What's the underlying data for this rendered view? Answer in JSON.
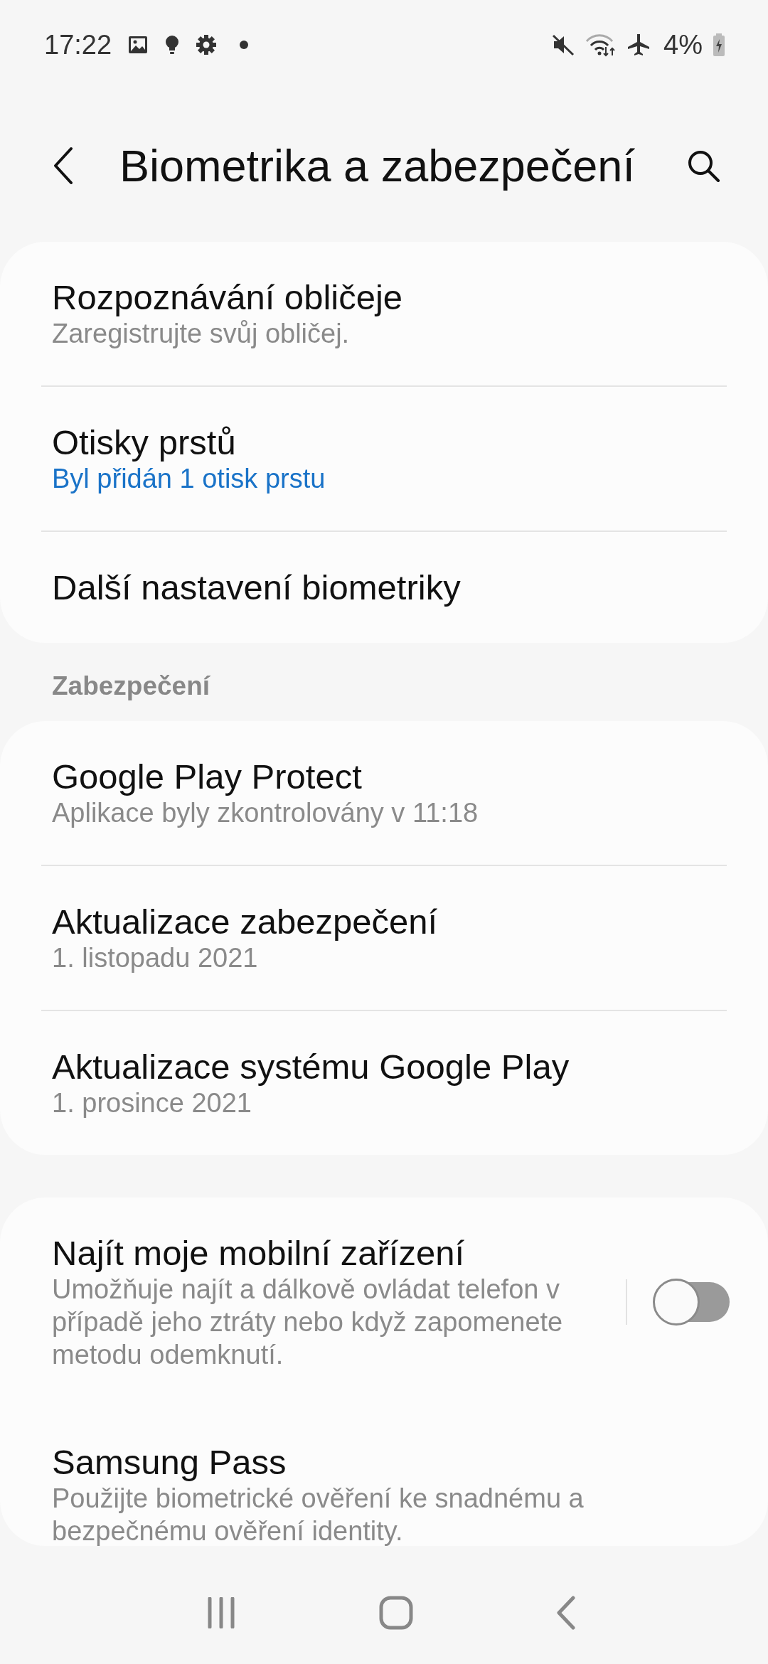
{
  "status_bar": {
    "time": "17:22",
    "battery": "4%"
  },
  "header": {
    "title": "Biometrika a zabezpečení"
  },
  "groups": [
    {
      "items": [
        {
          "title": "Rozpoznávání obličeje",
          "subtitle": "Zaregistrujte svůj obličej.",
          "subtitle_accent": false
        },
        {
          "title": "Otisky prstů",
          "subtitle": "Byl přidán 1 otisk prstu",
          "subtitle_accent": true
        },
        {
          "title": "Další nastavení biometriky"
        }
      ]
    },
    {
      "heading": "Zabezpečení",
      "items": [
        {
          "title": "Google Play Protect",
          "subtitle": "Aplikace byly zkontrolovány v 11:18",
          "subtitle_accent": false
        },
        {
          "title": "Aktualizace zabezpečení",
          "subtitle": "1. listopadu 2021",
          "subtitle_accent": false
        },
        {
          "title": "Aktualizace systému Google Play",
          "subtitle": "1. prosince 2021",
          "subtitle_accent": false
        }
      ]
    },
    {
      "items": [
        {
          "title": "Najít moje mobilní zařízení",
          "subtitle": "Umožňuje najít a dálkově ovládat telefon v případě jeho ztráty nebo když zapomenete metodu odemknutí.",
          "subtitle_accent": false,
          "on": false
        },
        {
          "title": "Samsung Pass",
          "subtitle": "Použijte biometrické ověření ke snadnému a bezpečnému ověření identity.",
          "subtitle_accent": false
        }
      ]
    }
  ]
}
